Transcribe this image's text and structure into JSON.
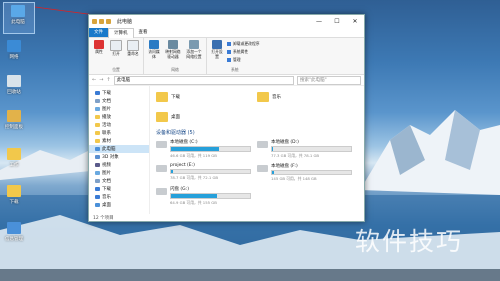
{
  "desktop": {
    "icons": [
      {
        "label": "此电脑",
        "color": "#5aa8e8"
      },
      {
        "label": "网络",
        "color": "#3b8bd6"
      },
      {
        "label": "回收站",
        "color": "#d9e3ea"
      },
      {
        "label": "控制面板",
        "color": "#e2b24a"
      },
      {
        "label": "工作",
        "color": "#f2c84b"
      },
      {
        "label": "下载",
        "color": "#f2c84b"
      },
      {
        "label": "信息管理",
        "color": "#4a90d9"
      }
    ]
  },
  "window": {
    "title": "此电脑",
    "controls": [
      "—",
      "☐",
      "✕"
    ],
    "tabs": {
      "file": "文件",
      "computer": "计算机",
      "view": "查看"
    },
    "ribbon": {
      "location": {
        "label": "位置",
        "buttons": [
          "属性",
          "打开",
          "重命名"
        ]
      },
      "media": {
        "buttons": [
          "访问媒体",
          "映射网络驱动器",
          "添加一个网络位置"
        ]
      },
      "network": {
        "label": "网络"
      },
      "system": {
        "label": "系统",
        "open_settings": "打开设置",
        "items": [
          "卸载或更改程序",
          "系统属性",
          "管理"
        ]
      }
    },
    "address": {
      "path": "此电脑",
      "search_placeholder": "搜索\"此电脑\""
    },
    "nav_pane": [
      {
        "label": "下载",
        "color": "#3a7bd5"
      },
      {
        "label": "文档",
        "color": "#7fa0c8"
      },
      {
        "label": "图片",
        "color": "#6aa9e0"
      },
      {
        "label": "播放",
        "color": "#f2c84b"
      },
      {
        "label": "活动",
        "color": "#f2c84b"
      },
      {
        "label": "联系",
        "color": "#f2c84b"
      },
      {
        "label": "素材",
        "color": "#f2c84b"
      },
      {
        "label": "此电脑",
        "color": "#4a90d9",
        "selected": true
      },
      {
        "label": "3D 对象",
        "color": "#5a8fd0"
      },
      {
        "label": "视频",
        "color": "#5a5a8a"
      },
      {
        "label": "图片",
        "color": "#6aa9e0"
      },
      {
        "label": "文档",
        "color": "#7fa0c8"
      },
      {
        "label": "下载",
        "color": "#3a7bd5"
      },
      {
        "label": "音乐",
        "color": "#3a7bd5"
      },
      {
        "label": "桌面",
        "color": "#4a90d9"
      }
    ],
    "folders": [
      {
        "label": "下载"
      },
      {
        "label": "音乐"
      },
      {
        "label": "桌面"
      }
    ],
    "devices_header": "设备和驱动器 (5)",
    "drives": [
      {
        "name": "本地磁盘 (C:)",
        "detail": "46.6 GB 可用，共 119 GB",
        "used": 0.61
      },
      {
        "name": "本地磁盘 (D:)",
        "detail": "77.3 GB 可用，共 78.1 GB",
        "used": 0.01
      },
      {
        "name": "project (E:)",
        "detail": "78.7 GB 可用，共 72.1 GB",
        "used": 0.02
      },
      {
        "name": "本地磁盘 (F:)",
        "detail": "145 GB 可用，共 148 GB",
        "used": 0.02
      },
      {
        "name": "闪盘 (G:)",
        "detail": "64.9 GB 可用，共 155 GB",
        "used": 0.58
      }
    ],
    "status": "12 个项目"
  },
  "watermark": "软件技巧"
}
